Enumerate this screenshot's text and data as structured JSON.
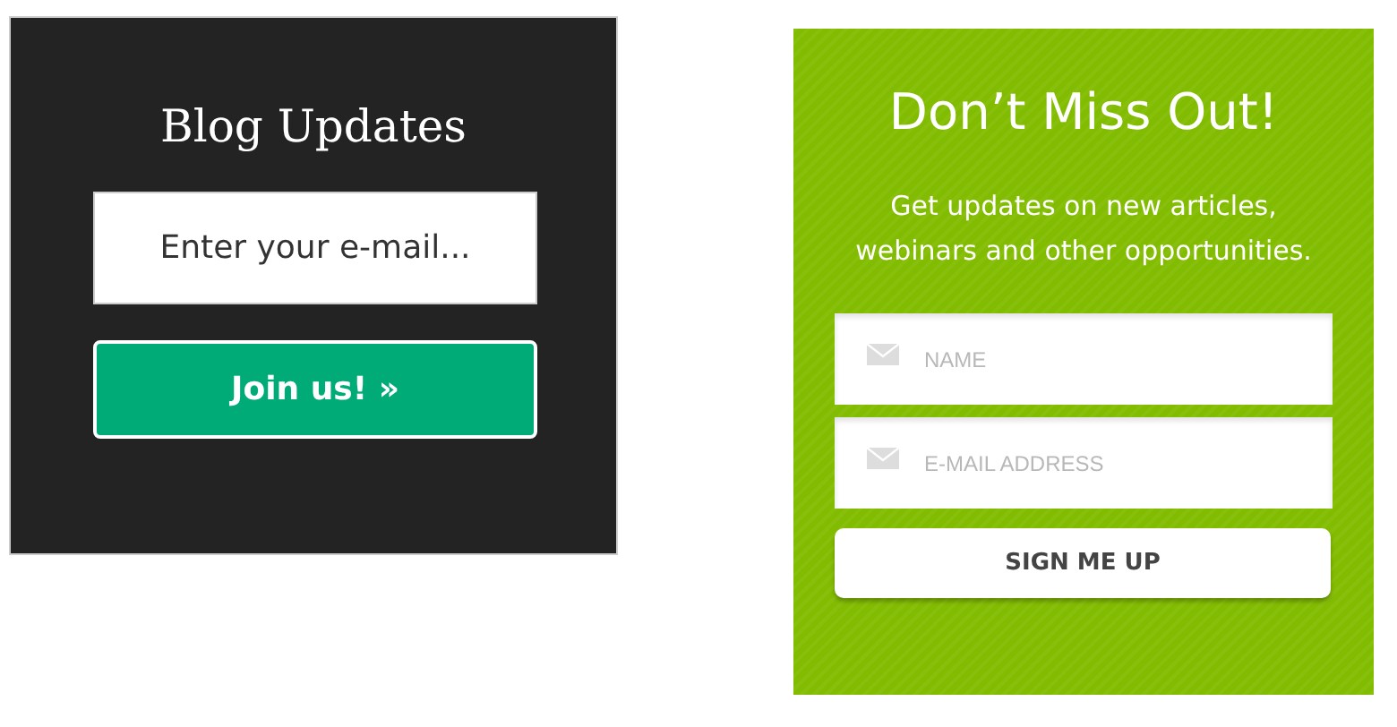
{
  "blog_signup": {
    "title": "Blog Updates",
    "email_field": {
      "placeholder": "Enter your e-mail..."
    },
    "button": "Join us! »"
  },
  "newsletter_signup": {
    "title": "Don’t Miss Out!",
    "description": "Get updates on new articles, webinars and other opportunities.",
    "fields": [
      {
        "placeholder": "NAME"
      },
      {
        "placeholder": "E-MAIL ADDRESS"
      }
    ],
    "button": "SIGN ME UP"
  }
}
